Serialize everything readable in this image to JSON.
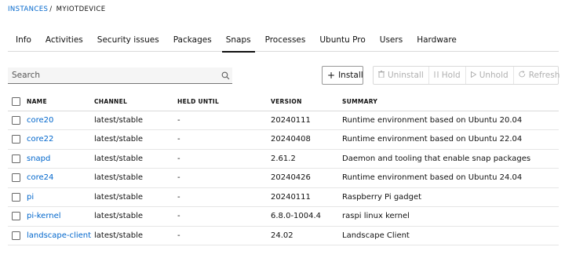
{
  "breadcrumb": {
    "root": "INSTANCES",
    "separator": "/",
    "current": "MYIOTDEVICE"
  },
  "tabs": [
    {
      "label": "Info",
      "active": false
    },
    {
      "label": "Activities",
      "active": false
    },
    {
      "label": "Security issues",
      "active": false
    },
    {
      "label": "Packages",
      "active": false
    },
    {
      "label": "Snaps",
      "active": true
    },
    {
      "label": "Processes",
      "active": false
    },
    {
      "label": "Ubuntu Pro",
      "active": false
    },
    {
      "label": "Users",
      "active": false
    },
    {
      "label": "Hardware",
      "active": false
    }
  ],
  "search": {
    "placeholder": "Search",
    "icon": "search-icon"
  },
  "toolbar": {
    "install": {
      "label": "Install",
      "glyph": "+"
    },
    "uninstall": {
      "label": "Uninstall",
      "glyph": "🗑"
    },
    "hold": {
      "label": "Hold",
      "glyph": "⏸"
    },
    "unhold": {
      "label": "Unhold",
      "glyph": "▷"
    },
    "refresh": {
      "label": "Refresh",
      "glyph": "↻"
    }
  },
  "table": {
    "columns": {
      "name": "NAME",
      "channel": "CHANNEL",
      "held_until": "HELD UNTIL",
      "version": "VERSION",
      "summary": "SUMMARY"
    },
    "rows": [
      {
        "name": "core20",
        "channel": "latest/stable",
        "held_until": "-",
        "version": "20240111",
        "summary": "Runtime environment based on Ubuntu 20.04"
      },
      {
        "name": "core22",
        "channel": "latest/stable",
        "held_until": "-",
        "version": "20240408",
        "summary": "Runtime environment based on Ubuntu 22.04"
      },
      {
        "name": "snapd",
        "channel": "latest/stable",
        "held_until": "-",
        "version": "2.61.2",
        "summary": "Daemon and tooling that enable snap packages"
      },
      {
        "name": "core24",
        "channel": "latest/stable",
        "held_until": "-",
        "version": "20240426",
        "summary": "Runtime environment based on Ubuntu 24.04"
      },
      {
        "name": "pi",
        "channel": "latest/stable",
        "held_until": "-",
        "version": "20240111",
        "summary": "Raspberry Pi gadget"
      },
      {
        "name": "pi-kernel",
        "channel": "latest/stable",
        "held_until": "-",
        "version": "6.8.0-1004.4",
        "summary": "raspi linux kernel"
      },
      {
        "name": "landscape-client",
        "channel": "latest/stable",
        "held_until": "-",
        "version": "24.02",
        "summary": "Landscape Client"
      }
    ]
  },
  "colors": {
    "link": "#0066cc",
    "tab_underline": "#111111",
    "disabled_text": "#b0b0b0"
  }
}
